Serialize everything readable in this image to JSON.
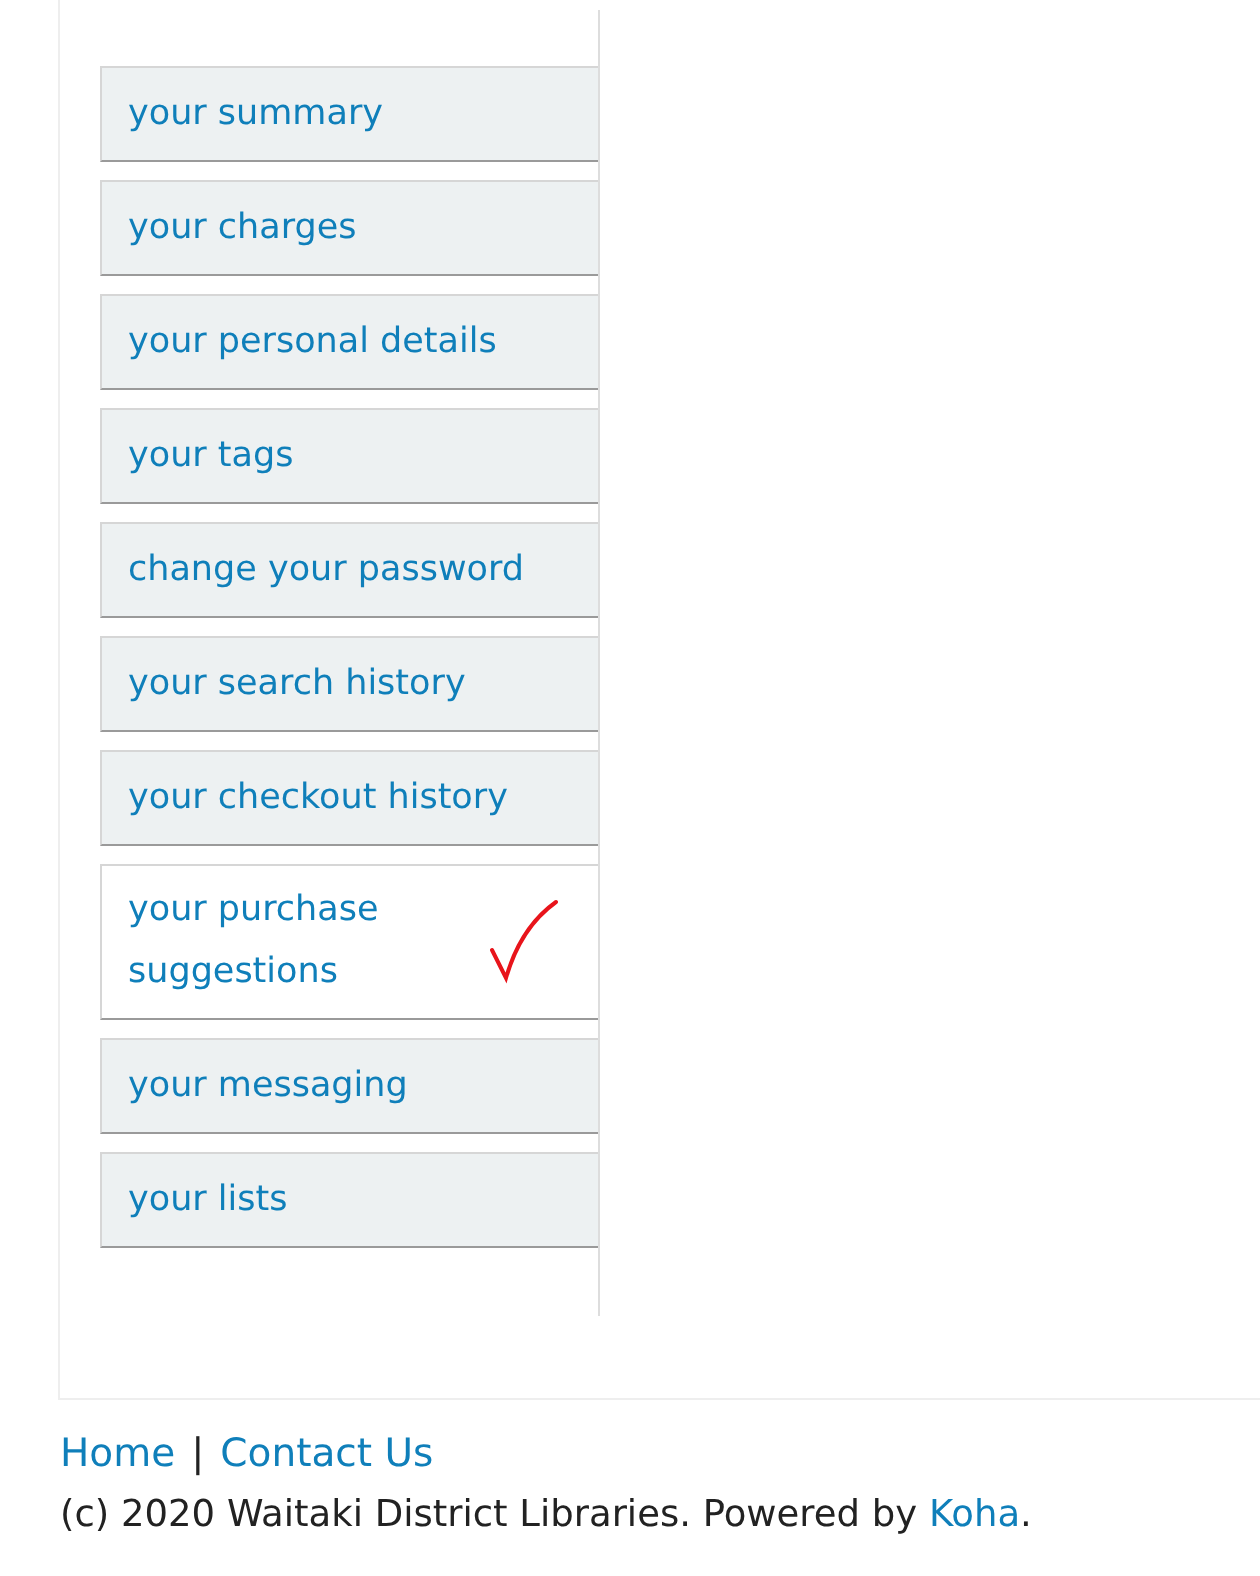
{
  "sidebar": {
    "items": [
      {
        "label": "your summary",
        "selected": false
      },
      {
        "label": "your charges",
        "selected": false
      },
      {
        "label": "your personal details",
        "selected": false
      },
      {
        "label": "your tags",
        "selected": false
      },
      {
        "label": "change your password",
        "selected": false
      },
      {
        "label": "your search history",
        "selected": false
      },
      {
        "label": "your checkout history",
        "selected": false
      },
      {
        "label": "your purchase suggestions",
        "selected": true
      },
      {
        "label": "your messaging",
        "selected": false
      },
      {
        "label": "your lists",
        "selected": false
      }
    ]
  },
  "footer": {
    "links": [
      {
        "label": "Home"
      },
      {
        "label": "Contact Us"
      }
    ],
    "separator": "|",
    "copyright": {
      "text": "(c) 2020 Waitaki District Libraries. Powered by",
      "link": "Koha",
      "end": "."
    }
  }
}
